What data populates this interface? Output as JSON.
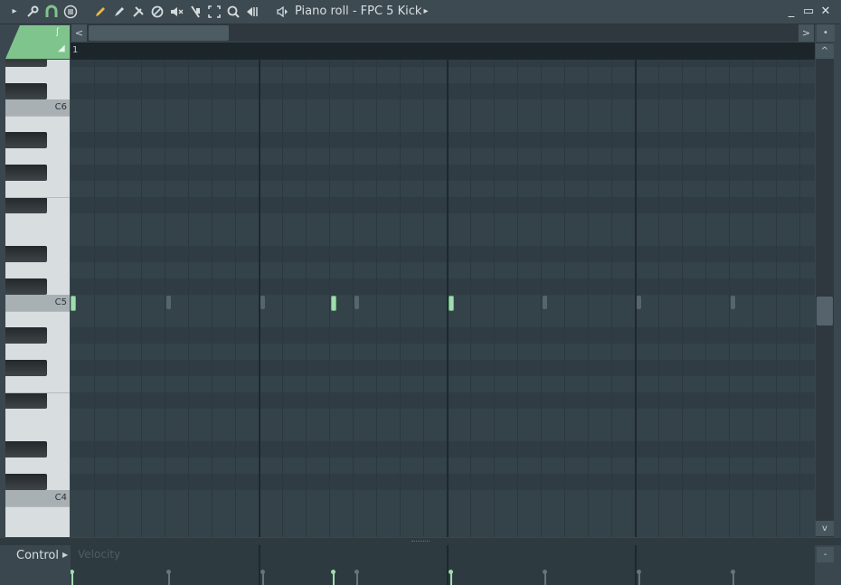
{
  "window": {
    "title": "Piano roll - FPC 5 Kick",
    "buttons": {
      "minimize": "_",
      "maximize": "▭",
      "close": "✕"
    }
  },
  "toolbar": {
    "tools": [
      {
        "name": "menu-arrow-icon",
        "glyph": "▸"
      },
      {
        "name": "wrench-icon",
        "glyph": "🔧"
      },
      {
        "name": "magnet-icon",
        "glyph": "∩"
      },
      {
        "name": "list-icon",
        "glyph": "≡"
      },
      {
        "name": "pencil-icon",
        "glyph": "✎"
      },
      {
        "name": "brush-icon",
        "glyph": "✐"
      },
      {
        "name": "delete-icon",
        "glyph": "✂"
      },
      {
        "name": "no-icon",
        "glyph": "⊘"
      },
      {
        "name": "mute-icon",
        "glyph": "🔇"
      },
      {
        "name": "slice-icon",
        "glyph": "✂"
      },
      {
        "name": "select-icon",
        "glyph": "⛶"
      },
      {
        "name": "zoom-icon",
        "glyph": "🔍"
      },
      {
        "name": "playback-icon",
        "glyph": "◀"
      },
      {
        "name": "speaker-icon",
        "glyph": "◁"
      },
      {
        "name": "title-arrow-icon",
        "glyph": "▸"
      }
    ]
  },
  "ruler": {
    "bar_label": "1"
  },
  "keyboard": {
    "labels": [
      "C6",
      "C5",
      "C4"
    ]
  },
  "control": {
    "label": "Control",
    "parameter": "Velocity",
    "min_button": "-"
  },
  "scroll": {
    "left_arrow": "<",
    "right_arrow": ">",
    "menu": "•",
    "up_arrow": "^",
    "down_arrow": "v"
  },
  "notes": {
    "pitch": "C5",
    "steps": [
      {
        "step": 0,
        "selected": true
      },
      {
        "step": 4,
        "selected": false
      },
      {
        "step": 8,
        "selected": false
      },
      {
        "step": 11,
        "selected": true
      },
      {
        "step": 12,
        "selected": false
      },
      {
        "step": 16,
        "selected": true
      },
      {
        "step": 20,
        "selected": false
      },
      {
        "step": 24,
        "selected": false
      },
      {
        "step": 28,
        "selected": false
      }
    ]
  },
  "colors": {
    "accent": "#9fdcae",
    "grid": "#344249",
    "background": "#3a474f"
  }
}
